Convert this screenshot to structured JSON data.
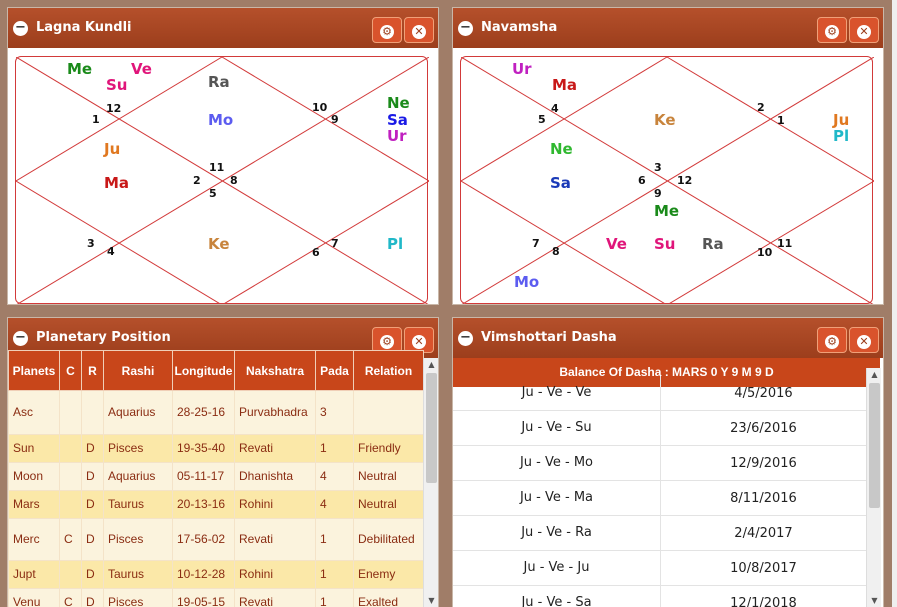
{
  "colors": {
    "header": "#a8461f",
    "grid_line": "#d23a3a",
    "table_head": "#c8461a",
    "row_odd": "#fbf3dd",
    "row_even": "#fbe8a8",
    "cell_text": "#8a2c12"
  },
  "lagna": {
    "title": "Lagna Kundli",
    "planets": {
      "me": "Me",
      "ve": "Ve",
      "su": "Su",
      "ra": "Ra",
      "mo": "Mo",
      "ne": "Ne",
      "sa": "Sa",
      "ur": "Ur",
      "ju": "Ju",
      "ma": "Ma",
      "ke": "Ke",
      "pl": "Pl"
    },
    "houses": {
      "h1": "1",
      "h12": "12",
      "h10": "10",
      "h9": "9",
      "h11": "11",
      "h2": "2",
      "h8": "8",
      "h5": "5",
      "h3": "3",
      "h4": "4",
      "h6": "6",
      "h7": "7"
    }
  },
  "navamsha": {
    "title": "Navamsha",
    "planets": {
      "ur": "Ur",
      "ma": "Ma",
      "ke": "Ke",
      "ju": "Ju",
      "pl": "Pl",
      "ne": "Ne",
      "sa": "Sa",
      "me": "Me",
      "ve": "Ve",
      "su": "Su",
      "ra": "Ra",
      "mo": "Mo"
    },
    "houses": {
      "h5": "5",
      "h4": "4",
      "h2": "2",
      "h1": "1",
      "h3": "3",
      "h6": "6",
      "h12": "12",
      "h9": "9",
      "h7": "7",
      "h8": "8",
      "h11": "11",
      "h10": "10"
    }
  },
  "planetary": {
    "title": "Planetary Position",
    "headers": [
      "Planets",
      "C",
      "R",
      "Rashi",
      "Longitude",
      "Nakshatra",
      "Pada",
      "Relation"
    ],
    "rows": [
      [
        "Asc",
        "",
        "",
        "Aquarius",
        "28-25-16",
        "Purvabhadra",
        "3",
        ""
      ],
      [
        "Sun",
        "",
        "D",
        "Pisces",
        "19-35-40",
        "Revati",
        "1",
        "Friendly"
      ],
      [
        "Moon",
        "",
        "D",
        "Aquarius",
        "05-11-17",
        "Dhanishta",
        "4",
        "Neutral"
      ],
      [
        "Mars",
        "",
        "D",
        "Taurus",
        "20-13-16",
        "Rohini",
        "4",
        "Neutral"
      ],
      [
        "Merc",
        "C",
        "D",
        "Pisces",
        "17-56-02",
        "Revati",
        "1",
        "Debilitated"
      ],
      [
        "Jupt",
        "",
        "D",
        "Taurus",
        "10-12-28",
        "Rohini",
        "1",
        "Enemy"
      ],
      [
        "Venu",
        "C",
        "D",
        "Pisces",
        "19-05-15",
        "Revati",
        "1",
        "Exalted"
      ]
    ]
  },
  "dasha": {
    "title": "Vimshottari Dasha",
    "balance": "Balance Of Dasha : MARS 0 Y 9 M 9 D",
    "rows": [
      [
        "Ju - Ve - Ve",
        "4/5/2016"
      ],
      [
        "Ju - Ve - Su",
        "23/6/2016"
      ],
      [
        "Ju - Ve - Mo",
        "12/9/2016"
      ],
      [
        "Ju - Ve - Ma",
        "8/11/2016"
      ],
      [
        "Ju - Ve - Ra",
        "2/4/2017"
      ],
      [
        "Ju - Ve - Ju",
        "10/8/2017"
      ],
      [
        "Ju - Ve - Sa",
        "12/1/2018"
      ]
    ]
  }
}
